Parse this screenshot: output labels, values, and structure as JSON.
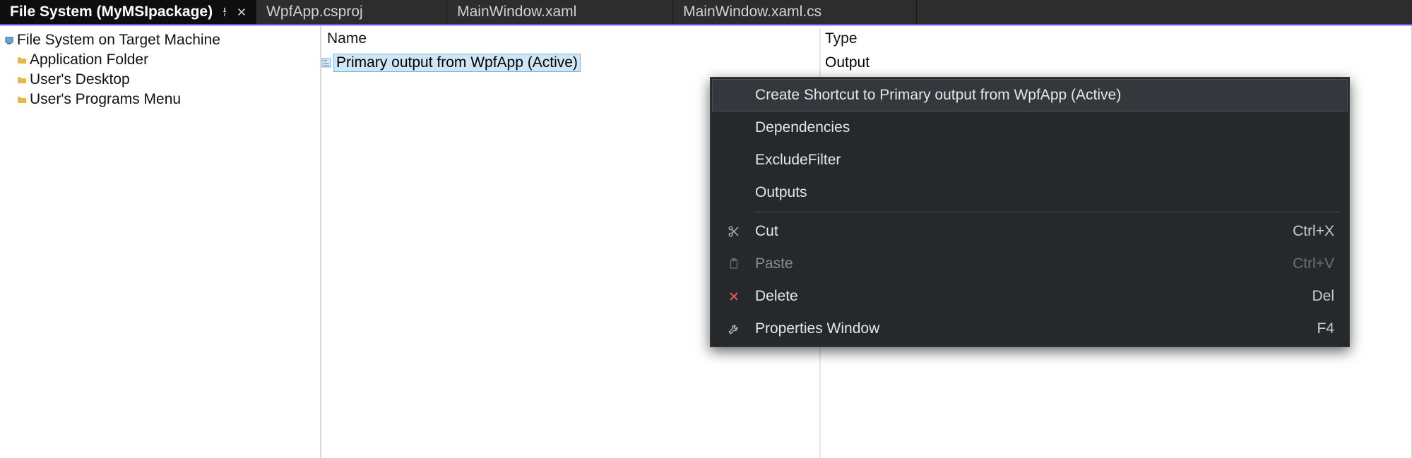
{
  "tabs": {
    "active": "File System (MyMSIpackage)",
    "list": [
      "WpfApp.csproj",
      "MainWindow.xaml",
      "MainWindow.xaml.cs"
    ]
  },
  "tree": {
    "root": "File System on Target Machine",
    "children": [
      "Application Folder",
      "User's Desktop",
      "User's Programs Menu"
    ]
  },
  "grid": {
    "headers": {
      "name": "Name",
      "type": "Type"
    },
    "rows": [
      {
        "name": "Primary output from WpfApp (Active)",
        "type": "Output"
      }
    ]
  },
  "context_menu": {
    "items": [
      {
        "label": "Create Shortcut to Primary output from WpfApp (Active)",
        "highlight": true
      },
      {
        "label": "Dependencies"
      },
      {
        "label": "ExcludeFilter"
      },
      {
        "label": "Outputs"
      }
    ],
    "edit": {
      "cut": {
        "label": "Cut",
        "keys": "Ctrl+X"
      },
      "paste": {
        "label": "Paste",
        "keys": "Ctrl+V"
      },
      "delete": {
        "label": "Delete",
        "keys": "Del"
      },
      "props": {
        "label": "Properties Window",
        "keys": "F4"
      }
    }
  }
}
